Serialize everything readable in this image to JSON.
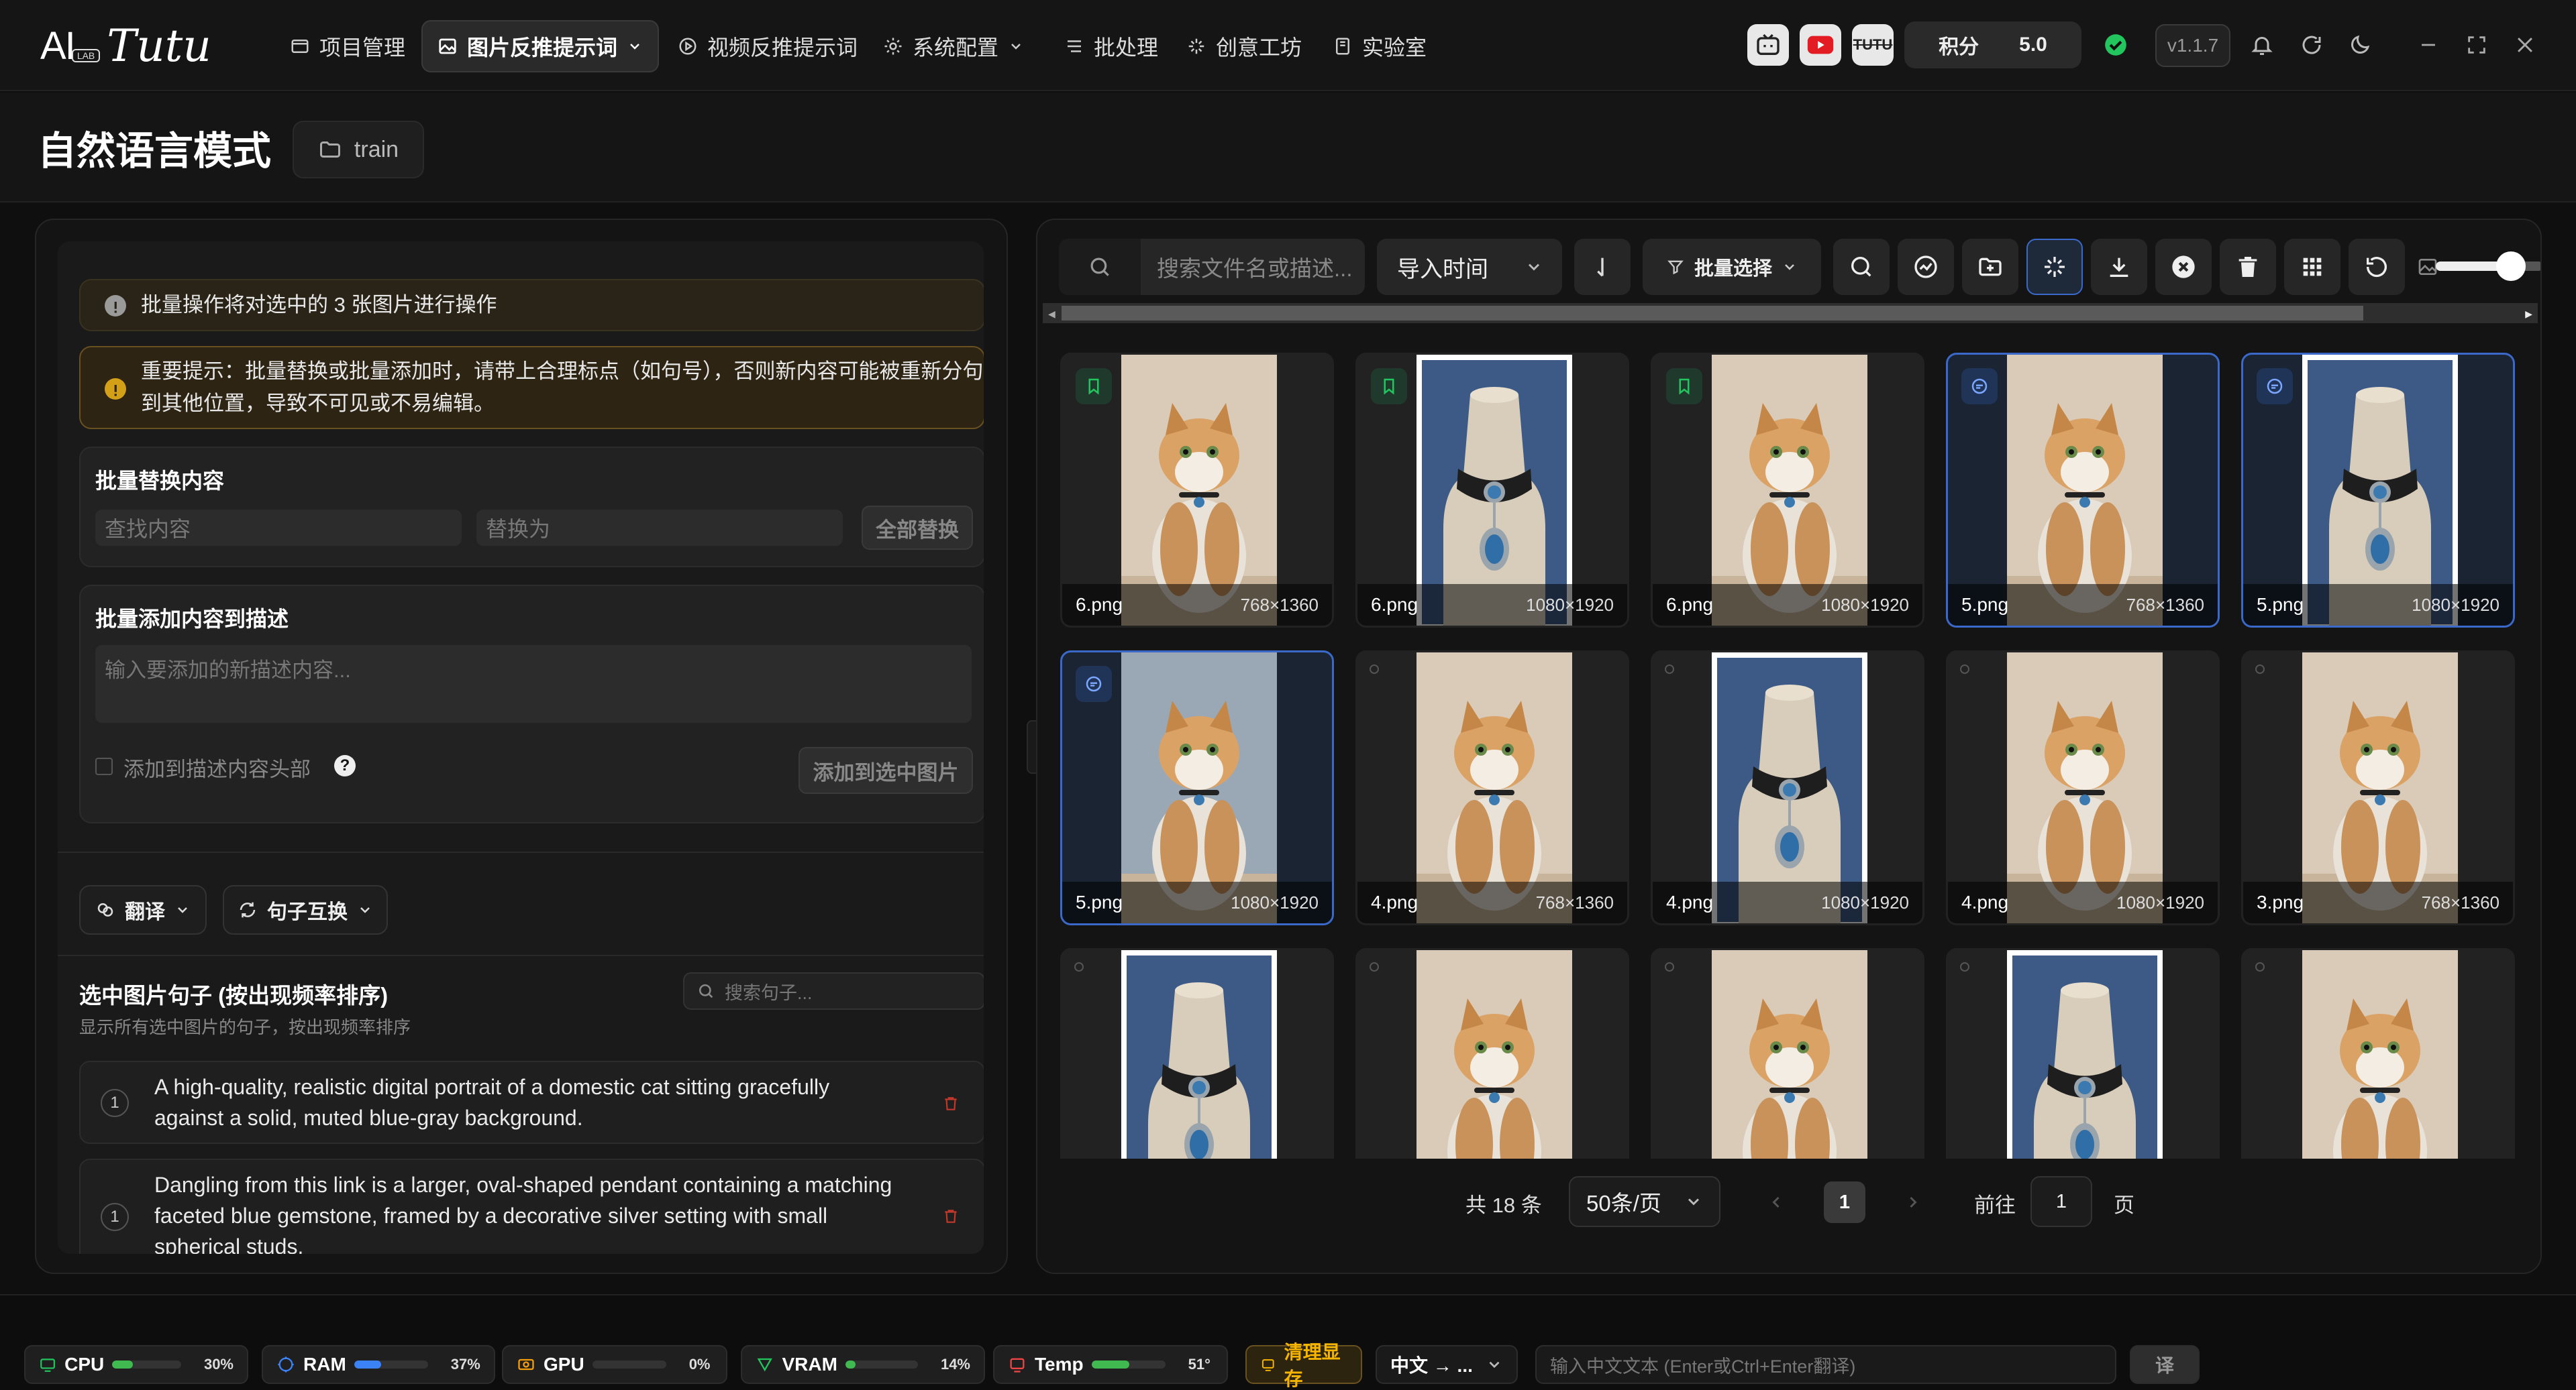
{
  "app": {
    "logo_text": "AI",
    "logo_lab": "LAB",
    "logo_script": "Tutu"
  },
  "nav": [
    {
      "label": "项目管理",
      "icon": "folder-icon"
    },
    {
      "label": "图片反推提示词",
      "icon": "image-icon",
      "active": true
    },
    {
      "label": "视频反推提示词",
      "icon": "play-circle-icon"
    },
    {
      "label": "系统配置",
      "icon": "gear-icon"
    },
    {
      "label": "批处理",
      "icon": "list-icon"
    },
    {
      "label": "创意工坊",
      "icon": "sparkle-icon"
    },
    {
      "label": "实验室",
      "icon": "flask-icon"
    }
  ],
  "topright": {
    "points_label": "积分",
    "points_value": "5.0",
    "version": "v1.1.7",
    "tutu_badge": "TUTU"
  },
  "header": {
    "title": "自然语言模式",
    "folder": "train"
  },
  "left": {
    "notice_info": "批量操作将对选中的 3 张图片进行操作",
    "notice_warn_line1": "重要提示：批量替换或批量添加时，请带上合理标点（如句号），否则新内容可能被重新分句",
    "notice_warn_line2": "到其他位置，导致不可见或不易编辑。",
    "replace_title": "批量替换内容",
    "find_placeholder": "查找内容",
    "replace_placeholder": "替换为",
    "replace_all": "全部替换",
    "add_title": "批量添加内容到描述",
    "add_placeholder": "输入要添加的新描述内容...",
    "add_to_head": "添加到描述内容头部",
    "add_to_selected": "添加到选中图片",
    "translate_label": "翻译",
    "swap_label": "句子互换",
    "sentences_title": "选中图片句子 (按出现频率排序)",
    "sentences_subtitle": "显示所有选中图片的句子，按出现频率排序",
    "sentence_search_placeholder": "搜索句子...",
    "sentences": [
      {
        "count": "1",
        "line1": "A high-quality, realistic digital portrait of a domestic cat sitting gracefully",
        "line2": "against a solid, muted blue-gray background.",
        "line3": ""
      },
      {
        "count": "1",
        "line1": "Dangling from this link is a larger, oval-shaped pendant containing a matching",
        "line2": "faceted blue gemstone, framed by a decorative silver setting with small",
        "line3": "spherical studs."
      }
    ]
  },
  "gallery": {
    "search_placeholder": "搜索文件名或描述...",
    "sort_label": "导入时间",
    "batch_select": "批量选择",
    "total": "共 18 条",
    "page_size": "50条/页",
    "current_page": "1",
    "goto_label": "前往",
    "goto_value": "1",
    "page_suffix": "页",
    "zoom_level": 0.7,
    "items": [
      {
        "name": "6.png",
        "dim": "768×1360",
        "kind": "cat",
        "badge": "tag",
        "selected": false
      },
      {
        "name": "6.png",
        "dim": "1080×1920",
        "kind": "collar",
        "badge": "tag",
        "selected": false
      },
      {
        "name": "6.png",
        "dim": "1080×1920",
        "kind": "cat",
        "badge": "tag",
        "selected": false
      },
      {
        "name": "5.png",
        "dim": "768×1360",
        "kind": "cat",
        "badge": "chat",
        "selected": true
      },
      {
        "name": "5.png",
        "dim": "1080×1920",
        "kind": "collar",
        "badge": "chat",
        "selected": true
      },
      {
        "name": "5.png",
        "dim": "1080×1920",
        "kind": "cat-blue",
        "badge": "chat",
        "selected": true
      },
      {
        "name": "4.png",
        "dim": "768×1360",
        "kind": "cat",
        "badge": "",
        "selected": false
      },
      {
        "name": "4.png",
        "dim": "1080×1920",
        "kind": "collar",
        "badge": "",
        "selected": false
      },
      {
        "name": "4.png",
        "dim": "1080×1920",
        "kind": "cat",
        "badge": "",
        "selected": false
      },
      {
        "name": "3.png",
        "dim": "768×1360",
        "kind": "cat",
        "badge": "",
        "selected": false
      },
      {
        "name": "",
        "dim": "",
        "kind": "collar",
        "badge": "",
        "selected": false
      },
      {
        "name": "",
        "dim": "",
        "kind": "cat",
        "badge": "",
        "selected": false
      },
      {
        "name": "",
        "dim": "",
        "kind": "cat",
        "badge": "",
        "selected": false
      },
      {
        "name": "",
        "dim": "",
        "kind": "collar",
        "badge": "",
        "selected": false
      },
      {
        "name": "",
        "dim": "",
        "kind": "cat",
        "badge": "",
        "selected": false
      }
    ]
  },
  "status": {
    "cpu": {
      "label": "CPU",
      "pct": "30%",
      "value": 30,
      "color": "#3fb950"
    },
    "ram": {
      "label": "RAM",
      "pct": "37%",
      "value": 37,
      "color": "#3b82f6"
    },
    "gpu": {
      "label": "GPU",
      "pct": "0%",
      "value": 0,
      "color": "#f59e0b"
    },
    "vram": {
      "label": "VRAM",
      "pct": "14%",
      "value": 14,
      "color": "#3fb950"
    },
    "temp": {
      "label": "Temp",
      "pct": "51°",
      "value": 51,
      "color": "#3fb950"
    },
    "clear_vram": "清理显存",
    "lang": "中文 → ...",
    "translate_placeholder": "输入中文文本 (Enter或Ctrl+Enter翻译)",
    "translate_btn": "译"
  }
}
